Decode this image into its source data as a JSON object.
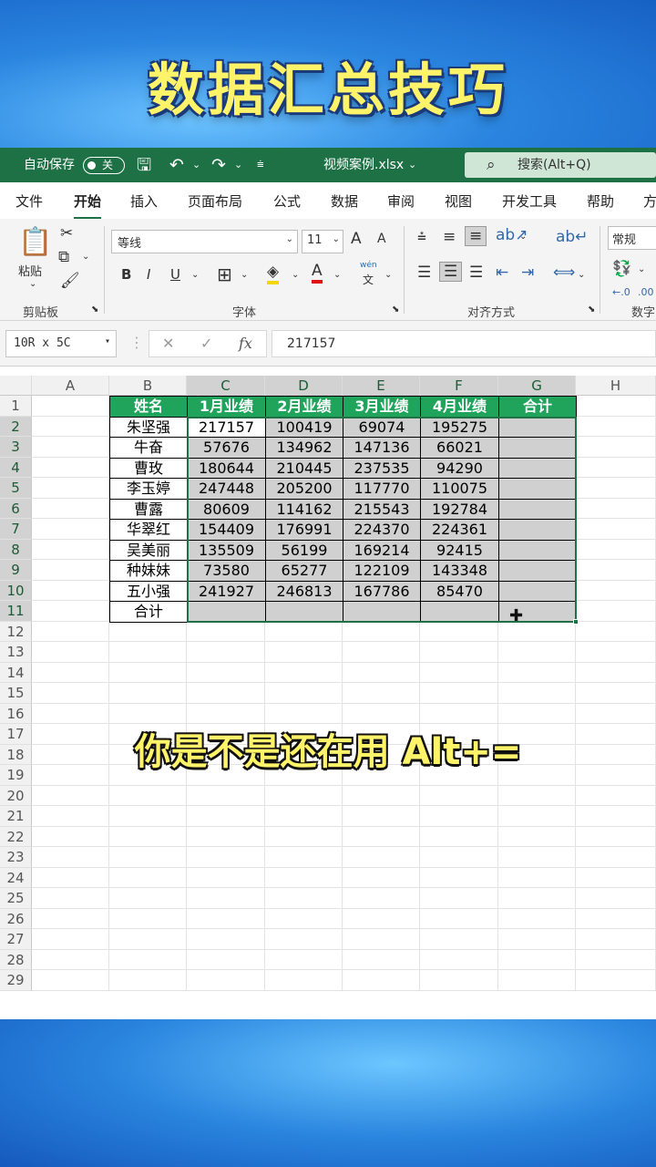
{
  "overlay_title": "数据汇总技巧",
  "overlay_subtitle": "你是不是还在用 Alt+=",
  "titlebar": {
    "autosave": "自动保存",
    "toggle": "关",
    "filename": "视频案例.xlsx",
    "search": "搜索(Alt+Q)"
  },
  "tabs": [
    "文件",
    "开始",
    "插入",
    "页面布局",
    "公式",
    "数据",
    "审阅",
    "视图",
    "开发工具",
    "帮助",
    "方"
  ],
  "ribbon": {
    "paste": "粘贴",
    "clipboard": "剪贴板",
    "font_name": "等线",
    "font_size": "11",
    "font_group": "字体",
    "align_group": "对齐方式",
    "number_format": "常规",
    "number_group": "数字",
    "bold": "B",
    "italic": "I",
    "underline": "U",
    "font_grow": "A",
    "font_shrink": "A",
    "wen": "wén"
  },
  "formula_bar": {
    "name_box": "10R x 5C",
    "cancel": "✕",
    "enter": "✓",
    "fx": "fx",
    "value": "217157"
  },
  "columns": [
    "A",
    "B",
    "C",
    "D",
    "E",
    "F",
    "G",
    "H"
  ],
  "rows": [
    "1",
    "2",
    "3",
    "4",
    "5",
    "6",
    "7",
    "8",
    "9",
    "10",
    "11",
    "12",
    "13",
    "14",
    "15",
    "16",
    "17",
    "18",
    "19",
    "20",
    "21",
    "22",
    "23",
    "24",
    "25",
    "26",
    "27",
    "28",
    "29"
  ],
  "table": {
    "headers": [
      "姓名",
      "1月业绩",
      "2月业绩",
      "3月业绩",
      "4月业绩",
      "合计"
    ],
    "rows": [
      [
        "朱坚强",
        "217157",
        "100419",
        "69074",
        "195275",
        ""
      ],
      [
        "牛奋",
        "57676",
        "134962",
        "147136",
        "66021",
        ""
      ],
      [
        "曹玫",
        "180644",
        "210445",
        "237535",
        "94290",
        ""
      ],
      [
        "李玉婷",
        "247448",
        "205200",
        "117770",
        "110075",
        ""
      ],
      [
        "曹露",
        "80609",
        "114162",
        "215543",
        "192784",
        ""
      ],
      [
        "华翠红",
        "154409",
        "176991",
        "224370",
        "224361",
        ""
      ],
      [
        "吴美丽",
        "135509",
        "56199",
        "169214",
        "92415",
        ""
      ],
      [
        "种妹妹",
        "73580",
        "65277",
        "122109",
        "143348",
        ""
      ],
      [
        "五小强",
        "241927",
        "246813",
        "167786",
        "85470",
        ""
      ],
      [
        "合计",
        "",
        "",
        "",
        "",
        ""
      ]
    ]
  },
  "colors": {
    "excel_green": "#1e7145",
    "header_fill": "#20a35a",
    "selection_fill": "#d0d0d0",
    "overlay_text": "#fff36a"
  }
}
